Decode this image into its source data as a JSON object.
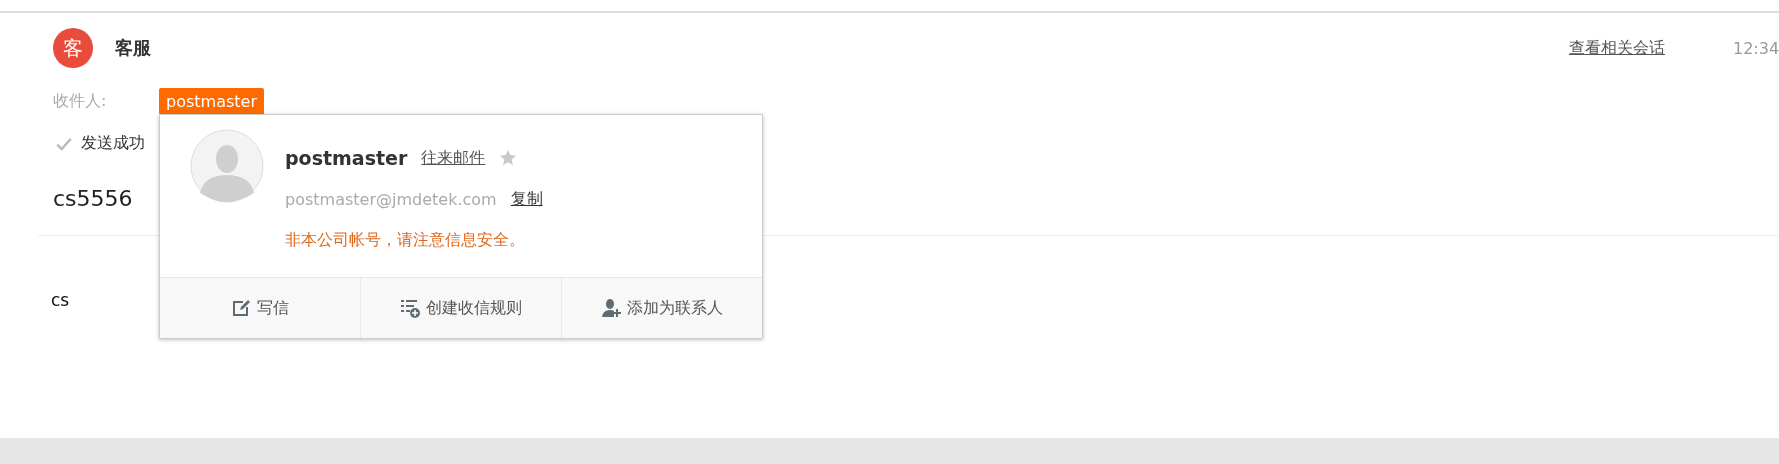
{
  "sender": {
    "avatar": "客",
    "name": "客服"
  },
  "related_link": "查看相关会话",
  "time": "12:34",
  "recipients": {
    "label": "收件人:",
    "items": [
      {
        "name": "postmaster",
        "selected": true
      }
    ]
  },
  "status": "发送成功",
  "subject": "cs5556",
  "body": "cs",
  "contact_card": {
    "name": "postmaster",
    "history_link": "往来邮件",
    "starred": false,
    "email": "postmaster@jmdetek.com",
    "copy_link": "复制",
    "warning": "非本公司帐号，请注意信息安全。",
    "actions": [
      {
        "kind": "compose",
        "label": "写信"
      },
      {
        "kind": "rule",
        "label": "创建收信规则"
      },
      {
        "kind": "add-contact",
        "label": "添加为联系人"
      }
    ]
  }
}
